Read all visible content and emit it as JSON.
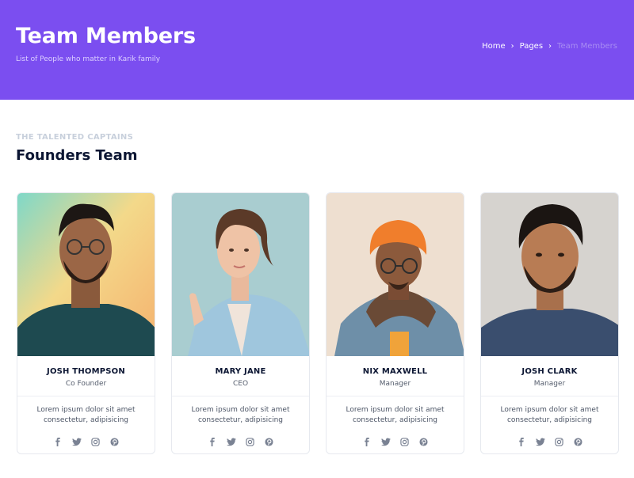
{
  "header": {
    "title": "Team Members",
    "subtitle": "List of People who matter in Karik family",
    "breadcrumb": [
      "Home",
      "Pages",
      "Team Members"
    ]
  },
  "section": {
    "eyebrow": "THE TALENTED CAPTAINS",
    "title": "Founders Team"
  },
  "members": [
    {
      "name": "JOSH THOMPSON",
      "role": "Co Founder",
      "desc": "Lorem ipsum dolor sit amet consectetur, adipisicing"
    },
    {
      "name": "MARY JANE",
      "role": "CEO",
      "desc": "Lorem ipsum dolor sit amet consectetur, adipisicing"
    },
    {
      "name": "NIX MAXWELL",
      "role": "Manager",
      "desc": "Lorem ipsum dolor sit amet consectetur, adipisicing"
    },
    {
      "name": "JOSH CLARK",
      "role": "Manager",
      "desc": "Lorem ipsum dolor sit amet consectetur, adipisicing"
    }
  ],
  "social_icons": [
    "facebook-icon",
    "twitter-icon",
    "instagram-icon",
    "pinterest-icon"
  ],
  "colors": {
    "primary": "#7b4ef0",
    "heading": "#0c1633",
    "muted": "#c8d0dc",
    "icon": "#7a8293"
  }
}
